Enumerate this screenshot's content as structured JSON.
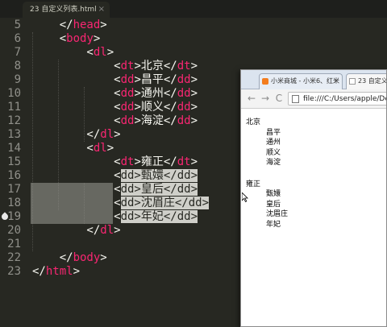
{
  "editor": {
    "tab_title": "23 自定义列表.html",
    "tab_close": "×",
    "lines": [
      {
        "n": "5",
        "parts": [
          [
            "br",
            "    </"
          ],
          [
            "tag",
            "head"
          ],
          [
            "br",
            ">"
          ]
        ]
      },
      {
        "n": "6",
        "parts": [
          [
            "br",
            "    <"
          ],
          [
            "tag",
            "body"
          ],
          [
            "br",
            ">"
          ]
        ]
      },
      {
        "n": "7",
        "parts": [
          [
            "br",
            "        <"
          ],
          [
            "tag",
            "dl"
          ],
          [
            "br",
            ">"
          ]
        ]
      },
      {
        "n": "8",
        "parts": [
          [
            "br",
            "            <"
          ],
          [
            "tag",
            "dt"
          ],
          [
            "br",
            ">北京</"
          ],
          [
            "tag",
            "dt"
          ],
          [
            "br",
            ">"
          ]
        ]
      },
      {
        "n": "9",
        "parts": [
          [
            "br",
            "            <"
          ],
          [
            "tag",
            "dd"
          ],
          [
            "br",
            ">昌平</"
          ],
          [
            "tag",
            "dd"
          ],
          [
            "br",
            ">"
          ]
        ]
      },
      {
        "n": "10",
        "parts": [
          [
            "br",
            "            <"
          ],
          [
            "tag",
            "dd"
          ],
          [
            "br",
            ">通州</"
          ],
          [
            "tag",
            "dd"
          ],
          [
            "br",
            ">"
          ]
        ]
      },
      {
        "n": "11",
        "parts": [
          [
            "br",
            "            <"
          ],
          [
            "tag",
            "dd"
          ],
          [
            "br",
            ">顺义</"
          ],
          [
            "tag",
            "dd"
          ],
          [
            "br",
            ">"
          ]
        ]
      },
      {
        "n": "12",
        "parts": [
          [
            "br",
            "            <"
          ],
          [
            "tag",
            "dd"
          ],
          [
            "br",
            ">海淀</"
          ],
          [
            "tag",
            "dd"
          ],
          [
            "br",
            ">"
          ]
        ]
      },
      {
        "n": "13",
        "parts": [
          [
            "br",
            "        </"
          ],
          [
            "tag",
            "dl"
          ],
          [
            "br",
            ">"
          ]
        ]
      },
      {
        "n": "14",
        "parts": [
          [
            "br",
            "        <"
          ],
          [
            "tag",
            "dl"
          ],
          [
            "br",
            ">"
          ]
        ]
      },
      {
        "n": "15",
        "parts": [
          [
            "br",
            "            <"
          ],
          [
            "tag",
            "dt"
          ],
          [
            "br",
            ">雍正</"
          ],
          [
            "tag",
            "dt"
          ],
          [
            "br",
            ">"
          ]
        ]
      },
      {
        "n": "16",
        "parts": [
          [
            "br",
            "            <"
          ],
          [
            "sel",
            "dd>甄嬛</dd>"
          ]
        ]
      },
      {
        "n": "17",
        "parts": [
          [
            "br",
            "            <"
          ],
          [
            "sel",
            "dd>皇后</dd>"
          ]
        ]
      },
      {
        "n": "18",
        "parts": [
          [
            "br",
            "            <"
          ],
          [
            "sel",
            "dd>沈眉庄</dd>"
          ]
        ]
      },
      {
        "n": "19",
        "parts": [
          [
            "br",
            "            <"
          ],
          [
            "sel",
            "dd>年妃</dd>"
          ]
        ]
      },
      {
        "n": "20",
        "parts": [
          [
            "br",
            "        </"
          ],
          [
            "tag",
            "dl"
          ],
          [
            "br",
            ">"
          ]
        ]
      },
      {
        "n": "21",
        "parts": []
      },
      {
        "n": "22",
        "parts": [
          [
            "br",
            "    </"
          ],
          [
            "tag",
            "body"
          ],
          [
            "br",
            ">"
          ]
        ]
      },
      {
        "n": "23",
        "parts": [
          [
            "br",
            "</"
          ],
          [
            "tag",
            "html"
          ],
          [
            "br",
            ">"
          ]
        ]
      }
    ]
  },
  "browser": {
    "tab1_title": "小米商城 - 小米6、红米",
    "tab2_title": "23 自定义",
    "tab_close": "×",
    "back_icon": "←",
    "forward_icon": "→",
    "reload_icon": "C",
    "url": "file:///C:/Users/apple/De",
    "content": [
      {
        "type": "dt",
        "text": "北京"
      },
      {
        "type": "dd",
        "text": "昌平"
      },
      {
        "type": "dd",
        "text": "通州"
      },
      {
        "type": "dd",
        "text": "顺义"
      },
      {
        "type": "dd",
        "text": "海淀"
      },
      {
        "type": "gap",
        "text": ""
      },
      {
        "type": "dt",
        "text": "雍正"
      },
      {
        "type": "dd",
        "text": "甄嬛"
      },
      {
        "type": "dd",
        "text": "皇后"
      },
      {
        "type": "dd",
        "text": "沈眉庄"
      },
      {
        "type": "dd",
        "text": "年妃"
      }
    ]
  },
  "colors": {
    "editor_bg": "#272822",
    "tag": "#f92672",
    "text": "#f8f8f2",
    "line_number": "#90908a",
    "selection": "#cfcfc9"
  }
}
